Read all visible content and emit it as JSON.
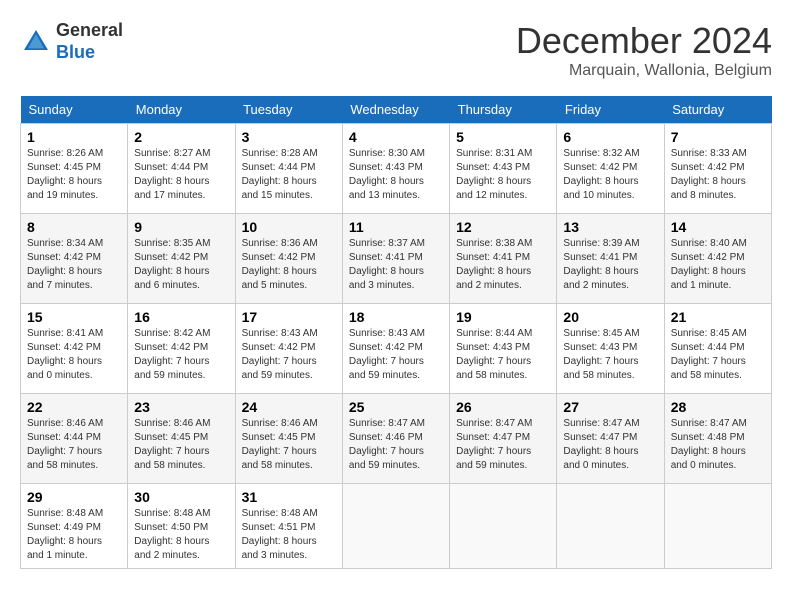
{
  "logo": {
    "general": "General",
    "blue": "Blue"
  },
  "header": {
    "month": "December 2024",
    "location": "Marquain, Wallonia, Belgium"
  },
  "days_of_week": [
    "Sunday",
    "Monday",
    "Tuesday",
    "Wednesday",
    "Thursday",
    "Friday",
    "Saturday"
  ],
  "weeks": [
    [
      {
        "day": "1",
        "sunrise": "8:26 AM",
        "sunset": "4:45 PM",
        "daylight": "8 hours and 19 minutes."
      },
      {
        "day": "2",
        "sunrise": "8:27 AM",
        "sunset": "4:44 PM",
        "daylight": "8 hours and 17 minutes."
      },
      {
        "day": "3",
        "sunrise": "8:28 AM",
        "sunset": "4:44 PM",
        "daylight": "8 hours and 15 minutes."
      },
      {
        "day": "4",
        "sunrise": "8:30 AM",
        "sunset": "4:43 PM",
        "daylight": "8 hours and 13 minutes."
      },
      {
        "day": "5",
        "sunrise": "8:31 AM",
        "sunset": "4:43 PM",
        "daylight": "8 hours and 12 minutes."
      },
      {
        "day": "6",
        "sunrise": "8:32 AM",
        "sunset": "4:42 PM",
        "daylight": "8 hours and 10 minutes."
      },
      {
        "day": "7",
        "sunrise": "8:33 AM",
        "sunset": "4:42 PM",
        "daylight": "8 hours and 8 minutes."
      }
    ],
    [
      {
        "day": "8",
        "sunrise": "8:34 AM",
        "sunset": "4:42 PM",
        "daylight": "8 hours and 7 minutes."
      },
      {
        "day": "9",
        "sunrise": "8:35 AM",
        "sunset": "4:42 PM",
        "daylight": "8 hours and 6 minutes."
      },
      {
        "day": "10",
        "sunrise": "8:36 AM",
        "sunset": "4:42 PM",
        "daylight": "8 hours and 5 minutes."
      },
      {
        "day": "11",
        "sunrise": "8:37 AM",
        "sunset": "4:41 PM",
        "daylight": "8 hours and 3 minutes."
      },
      {
        "day": "12",
        "sunrise": "8:38 AM",
        "sunset": "4:41 PM",
        "daylight": "8 hours and 2 minutes."
      },
      {
        "day": "13",
        "sunrise": "8:39 AM",
        "sunset": "4:41 PM",
        "daylight": "8 hours and 2 minutes."
      },
      {
        "day": "14",
        "sunrise": "8:40 AM",
        "sunset": "4:42 PM",
        "daylight": "8 hours and 1 minute."
      }
    ],
    [
      {
        "day": "15",
        "sunrise": "8:41 AM",
        "sunset": "4:42 PM",
        "daylight": "8 hours and 0 minutes."
      },
      {
        "day": "16",
        "sunrise": "8:42 AM",
        "sunset": "4:42 PM",
        "daylight": "7 hours and 59 minutes."
      },
      {
        "day": "17",
        "sunrise": "8:43 AM",
        "sunset": "4:42 PM",
        "daylight": "7 hours and 59 minutes."
      },
      {
        "day": "18",
        "sunrise": "8:43 AM",
        "sunset": "4:42 PM",
        "daylight": "7 hours and 59 minutes."
      },
      {
        "day": "19",
        "sunrise": "8:44 AM",
        "sunset": "4:43 PM",
        "daylight": "7 hours and 58 minutes."
      },
      {
        "day": "20",
        "sunrise": "8:45 AM",
        "sunset": "4:43 PM",
        "daylight": "7 hours and 58 minutes."
      },
      {
        "day": "21",
        "sunrise": "8:45 AM",
        "sunset": "4:44 PM",
        "daylight": "7 hours and 58 minutes."
      }
    ],
    [
      {
        "day": "22",
        "sunrise": "8:46 AM",
        "sunset": "4:44 PM",
        "daylight": "7 hours and 58 minutes."
      },
      {
        "day": "23",
        "sunrise": "8:46 AM",
        "sunset": "4:45 PM",
        "daylight": "7 hours and 58 minutes."
      },
      {
        "day": "24",
        "sunrise": "8:46 AM",
        "sunset": "4:45 PM",
        "daylight": "7 hours and 58 minutes."
      },
      {
        "day": "25",
        "sunrise": "8:47 AM",
        "sunset": "4:46 PM",
        "daylight": "7 hours and 59 minutes."
      },
      {
        "day": "26",
        "sunrise": "8:47 AM",
        "sunset": "4:47 PM",
        "daylight": "7 hours and 59 minutes."
      },
      {
        "day": "27",
        "sunrise": "8:47 AM",
        "sunset": "4:47 PM",
        "daylight": "8 hours and 0 minutes."
      },
      {
        "day": "28",
        "sunrise": "8:47 AM",
        "sunset": "4:48 PM",
        "daylight": "8 hours and 0 minutes."
      }
    ],
    [
      {
        "day": "29",
        "sunrise": "8:48 AM",
        "sunset": "4:49 PM",
        "daylight": "8 hours and 1 minute."
      },
      {
        "day": "30",
        "sunrise": "8:48 AM",
        "sunset": "4:50 PM",
        "daylight": "8 hours and 2 minutes."
      },
      {
        "day": "31",
        "sunrise": "8:48 AM",
        "sunset": "4:51 PM",
        "daylight": "8 hours and 3 minutes."
      },
      null,
      null,
      null,
      null
    ]
  ]
}
